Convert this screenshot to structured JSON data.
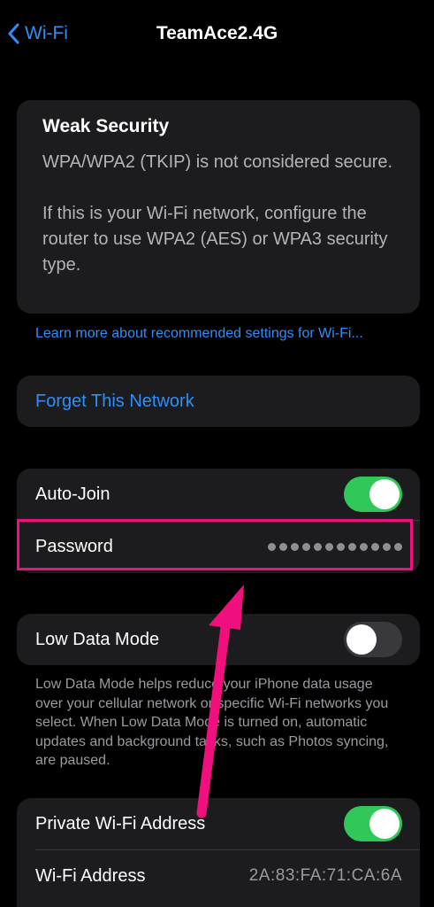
{
  "nav": {
    "back_label": "Wi-Fi",
    "title": "TeamAce2.4G"
  },
  "security_warning": {
    "title": "Weak Security",
    "paragraph1": "WPA/WPA2 (TKIP) is not considered secure.",
    "paragraph2": "If this is your Wi-Fi network, configure the router to use WPA2 (AES) or WPA3 security type."
  },
  "learn_more_link": "Learn more about recommended settings for Wi-Fi...",
  "forget_network_label": "Forget This Network",
  "settings": {
    "auto_join": {
      "label": "Auto-Join",
      "enabled": true
    },
    "password": {
      "label": "Password",
      "masked_value": "●●●●●●●●●●●●"
    },
    "low_data_mode": {
      "label": "Low Data Mode",
      "enabled": false,
      "description": "Low Data Mode helps reduce your iPhone data usage over your cellular network or specific Wi-Fi networks you select. When Low Data Mode is turned on, automatic updates and background tasks, such as Photos syncing, are paused."
    },
    "private_address": {
      "label": "Private Wi-Fi Address",
      "enabled": true
    },
    "wifi_address": {
      "label": "Wi-Fi Address",
      "value": "2A:83:FA:71:CA:6A"
    }
  },
  "annotation": {
    "highlight_color": "#f0107d",
    "target": "password-row"
  },
  "colors": {
    "background": "#000000",
    "card": "#1c1c1e",
    "accent_blue": "#2f8ef8",
    "toggle_on": "#32c759",
    "toggle_off": "#39393d"
  }
}
